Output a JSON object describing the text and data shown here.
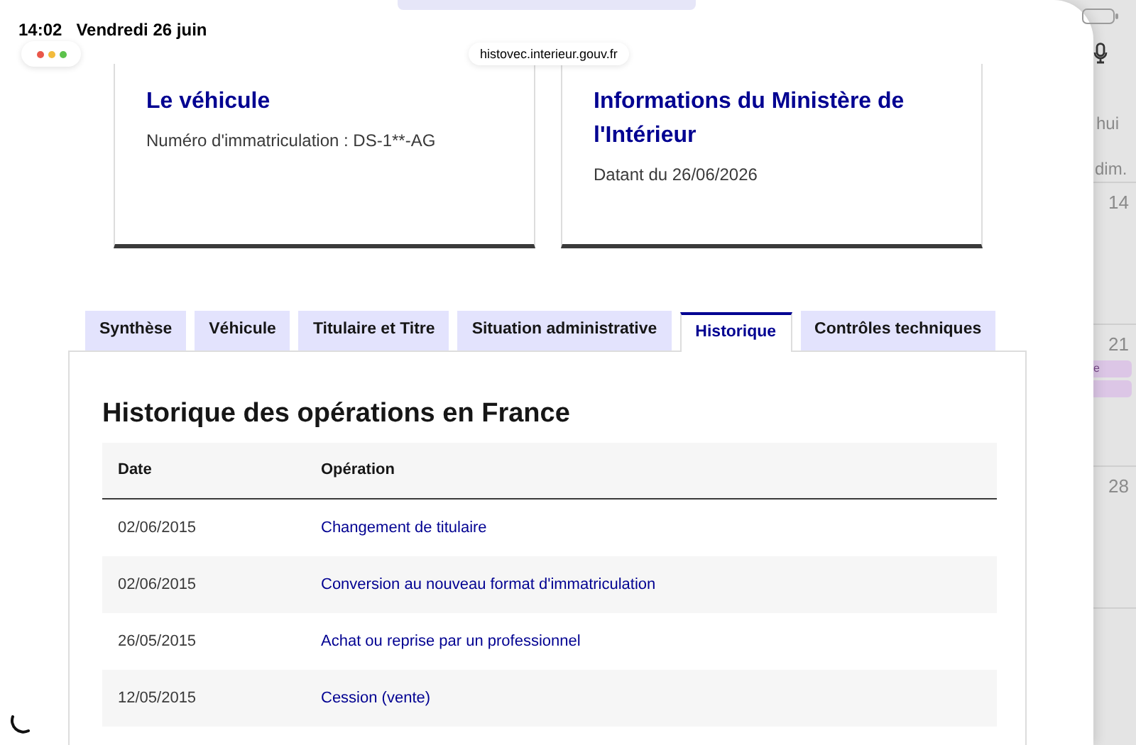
{
  "status_bar": {
    "time": "14:02",
    "date": "Vendredi 26 juin"
  },
  "browser": {
    "url": "histovec.interieur.gouv.fr",
    "loading": true
  },
  "cards": [
    {
      "title": "Le véhicule",
      "text": "Numéro d'immatriculation : DS-1**-AG"
    },
    {
      "title": "Informations du Ministère de l'Intérieur",
      "text": "Datant du 26/06/2026"
    }
  ],
  "tabs": [
    {
      "label": "Synthèse",
      "selected": false
    },
    {
      "label": "Véhicule",
      "selected": false
    },
    {
      "label": "Titulaire et Titre",
      "selected": false
    },
    {
      "label": "Situation administrative",
      "selected": false
    },
    {
      "label": "Historique",
      "selected": true
    },
    {
      "label": "Contrôles techniques",
      "selected": false
    }
  ],
  "panel": {
    "heading": "Historique des opérations en France",
    "table": {
      "columns": [
        "Date",
        "Opération"
      ],
      "rows": [
        [
          "02/06/2015",
          "Changement de titulaire"
        ],
        [
          "02/06/2015",
          "Conversion au nouveau format d'immatriculation"
        ],
        [
          "26/05/2015",
          "Achat ou reprise par un professionnel"
        ],
        [
          "12/05/2015",
          "Cession (vente)"
        ]
      ]
    }
  },
  "calendar": {
    "header": "hui",
    "weekday": "dim.",
    "days": [
      {
        "day": "14"
      },
      {
        "day": "21",
        "events": [
          {
            "kind": "labeled",
            "label": "e"
          },
          {
            "kind": "plain"
          }
        ]
      },
      {
        "day": "28"
      }
    ]
  }
}
